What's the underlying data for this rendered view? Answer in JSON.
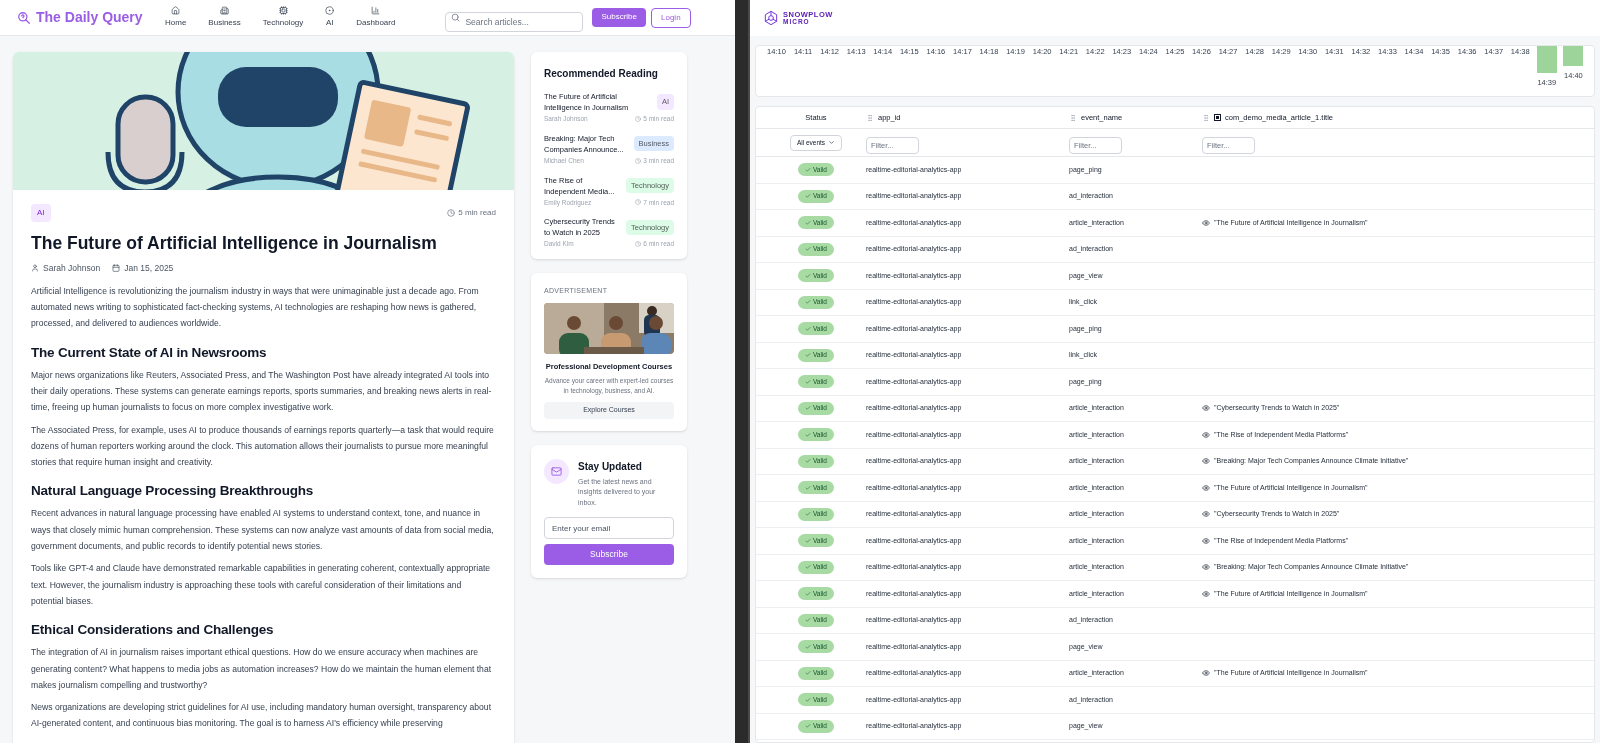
{
  "left_app": {
    "header": {
      "logo": "The Daily Query",
      "nav": [
        {
          "label": "Home"
        },
        {
          "label": "Business"
        },
        {
          "label": "Technology"
        },
        {
          "label": "AI"
        },
        {
          "label": "Dashboard"
        }
      ],
      "search": {
        "placeholder": "Search articles..."
      },
      "buttons": [
        {
          "label": "Subscribe",
          "kind": "primary"
        },
        {
          "label": "Login",
          "kind": "outline"
        }
      ]
    },
    "article": {
      "tag": "AI",
      "read_time": "5 min read",
      "title": "The Future of Artificial Intelligence in Journalism",
      "author": "Sarah Johnson",
      "date": "Jan 15, 2025",
      "blocks": [
        {
          "kind": "paragraph",
          "text": "Artificial Intelligence is revolutionizing the journalism industry in ways that were unimaginable just a decade ago. From automated news writing to sophisticated fact-checking systems, AI technologies are reshaping how news is gathered, processed, and delivered to audiences worldwide."
        },
        {
          "kind": "heading",
          "text": "The Current State of AI in Newsrooms"
        },
        {
          "kind": "paragraph",
          "text": "Major news organizations like Reuters, Associated Press, and The Washington Post have already integrated AI tools into their daily operations. These systems can generate earnings reports, sports summaries, and breaking news alerts in real-time, freeing up human journalists to focus on more complex investigative work."
        },
        {
          "kind": "paragraph",
          "text": "The Associated Press, for example, uses AI to produce thousands of earnings reports quarterly—a task that would require dozens of human reporters working around the clock. This automation allows their journalists to pursue more meaningful stories that require human insight and creativity."
        },
        {
          "kind": "heading",
          "text": "Natural Language Processing Breakthroughs"
        },
        {
          "kind": "paragraph",
          "text": "Recent advances in natural language processing have enabled AI systems to understand context, tone, and nuance in ways that closely mimic human comprehension. These systems can now analyze vast amounts of data from social media, government documents, and public records to identify potential news stories."
        },
        {
          "kind": "paragraph",
          "text": "Tools like GPT-4 and Claude have demonstrated remarkable capabilities in generating coherent, contextually appropriate text. However, the journalism industry is approaching these tools with careful consideration of their limitations and potential biases."
        },
        {
          "kind": "heading",
          "text": "Ethical Considerations and Challenges"
        },
        {
          "kind": "paragraph",
          "text": "The integration of AI in journalism raises important ethical questions. How do we ensure accuracy when machines are generating content? What happens to media jobs as automation increases? How do we maintain the human element that makes journalism compelling and trustworthy?"
        },
        {
          "kind": "paragraph",
          "text": "News organizations are developing strict guidelines for AI use, including mandatory human oversight, transparency about AI-generated content, and continuous bias monitoring. The goal is to harness AI's efficiency while preserving"
        }
      ]
    },
    "recommended": {
      "title": "Recommended Reading",
      "items": [
        {
          "title": "The Future of Artificial Intelligence in Journalism",
          "author": "Sarah Johnson",
          "read_time": "5 min read",
          "tag": "AI",
          "color": "#f3e8ff"
        },
        {
          "title": "Breaking: Major Tech Companies Announce...",
          "author": "Michael Chen",
          "read_time": "3 min read",
          "tag": "Business",
          "color": "#dbeafe"
        },
        {
          "title": "The Rise of Independent Media...",
          "author": "Emily Rodriguez",
          "read_time": "7 min read",
          "tag": "Technology",
          "color": "#dcfce7"
        },
        {
          "title": "Cybersecurity Trends to Watch in 2025",
          "author": "David Kim",
          "read_time": "6 min read",
          "tag": "Technology",
          "color": "#dcfce7"
        }
      ]
    },
    "ad": {
      "label": "ADVERTISEMENT",
      "title": "Professional Development Courses",
      "text": "Advance your career with expert-led courses in technology, business, and AI.",
      "button": "Explore Courses"
    },
    "newsletter": {
      "title": "Stay Updated",
      "text": "Get the latest news and insights delivered to your inbox.",
      "placeholder": "Enter your email",
      "button": "Subscribe"
    }
  },
  "right_app": {
    "logo": {
      "name": "SNOWPLOW",
      "sub": "MICRO"
    },
    "timeline": {
      "labels": [
        "14:10",
        "14:11",
        "14:12",
        "14:13",
        "14:14",
        "14:15",
        "14:16",
        "14:17",
        "14:18",
        "14:19",
        "14:20",
        "14:21",
        "14:22",
        "14:23",
        "14:24",
        "14:25",
        "14:26",
        "14:27",
        "14:28",
        "14:29",
        "14:30",
        "14:31",
        "14:32",
        "14:33",
        "14:34",
        "14:35",
        "14:36",
        "14:37",
        "14:38",
        "14:39",
        "14:40"
      ]
    },
    "table": {
      "columns": [
        {
          "label": "Status"
        },
        {
          "label": "app_id"
        },
        {
          "label": "event_name"
        },
        {
          "label": "com_demo_media_article_1.title"
        }
      ],
      "status_filter": "All events",
      "filters": [
        {
          "placeholder": "Filter..."
        },
        {
          "placeholder": "Filter..."
        },
        {
          "placeholder": "Filter..."
        }
      ],
      "rows": [
        {
          "status": "Valid",
          "app_id": "realtime-editorial-analytics-app",
          "event_name": "page_ping"
        },
        {
          "status": "Valid",
          "app_id": "realtime-editorial-analytics-app",
          "event_name": "ad_interaction"
        },
        {
          "status": "Valid",
          "app_id": "realtime-editorial-analytics-app",
          "event_name": "article_interaction",
          "title": "\"The Future of Artificial Intelligence in Journalism\""
        },
        {
          "status": "Valid",
          "app_id": "realtime-editorial-analytics-app",
          "event_name": "ad_interaction"
        },
        {
          "status": "Valid",
          "app_id": "realtime-editorial-analytics-app",
          "event_name": "page_view"
        },
        {
          "status": "Valid",
          "app_id": "realtime-editorial-analytics-app",
          "event_name": "link_click"
        },
        {
          "status": "Valid",
          "app_id": "realtime-editorial-analytics-app",
          "event_name": "page_ping"
        },
        {
          "status": "Valid",
          "app_id": "realtime-editorial-analytics-app",
          "event_name": "link_click"
        },
        {
          "status": "Valid",
          "app_id": "realtime-editorial-analytics-app",
          "event_name": "page_ping"
        },
        {
          "status": "Valid",
          "app_id": "realtime-editorial-analytics-app",
          "event_name": "article_interaction",
          "title": "\"Cybersecurity Trends to Watch in 2025\""
        },
        {
          "status": "Valid",
          "app_id": "realtime-editorial-analytics-app",
          "event_name": "article_interaction",
          "title": "\"The Rise of Independent Media Platforms\""
        },
        {
          "status": "Valid",
          "app_id": "realtime-editorial-analytics-app",
          "event_name": "article_interaction",
          "title": "\"Breaking: Major Tech Companies Announce Climate Initiative\""
        },
        {
          "status": "Valid",
          "app_id": "realtime-editorial-analytics-app",
          "event_name": "article_interaction",
          "title": "\"The Future of Artificial Intelligence in Journalism\""
        },
        {
          "status": "Valid",
          "app_id": "realtime-editorial-analytics-app",
          "event_name": "article_interaction",
          "title": "\"Cybersecurity Trends to Watch in 2025\""
        },
        {
          "status": "Valid",
          "app_id": "realtime-editorial-analytics-app",
          "event_name": "article_interaction",
          "title": "\"The Rise of Independent Media Platforms\""
        },
        {
          "status": "Valid",
          "app_id": "realtime-editorial-analytics-app",
          "event_name": "article_interaction",
          "title": "\"Breaking: Major Tech Companies Announce Climate Initiative\""
        },
        {
          "status": "Valid",
          "app_id": "realtime-editorial-analytics-app",
          "event_name": "article_interaction",
          "title": "\"The Future of Artificial Intelligence in Journalism\""
        },
        {
          "status": "Valid",
          "app_id": "realtime-editorial-analytics-app",
          "event_name": "ad_interaction"
        },
        {
          "status": "Valid",
          "app_id": "realtime-editorial-analytics-app",
          "event_name": "page_view"
        },
        {
          "status": "Valid",
          "app_id": "realtime-editorial-analytics-app",
          "event_name": "article_interaction",
          "title": "\"The Future of Artificial Intelligence in Journalism\""
        },
        {
          "status": "Valid",
          "app_id": "realtime-editorial-analytics-app",
          "event_name": "ad_interaction"
        },
        {
          "status": "Valid",
          "app_id": "realtime-editorial-analytics-app",
          "event_name": "page_view"
        }
      ]
    }
  }
}
